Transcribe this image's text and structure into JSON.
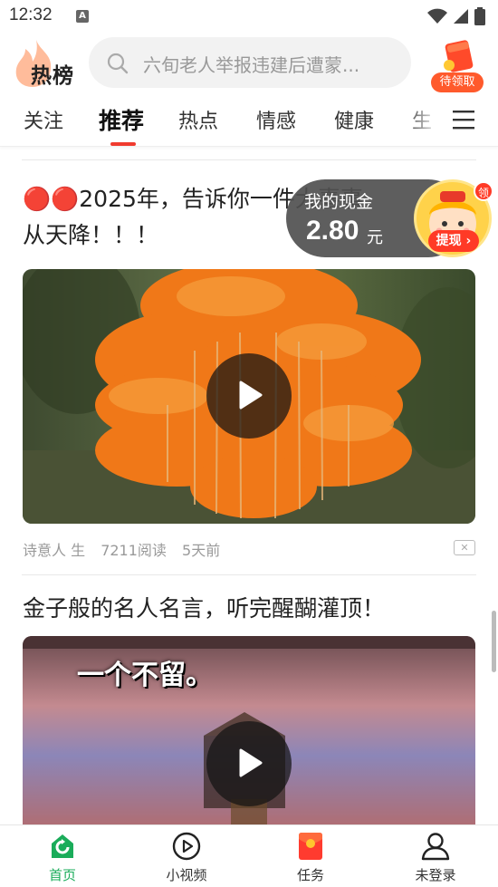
{
  "status_bar": {
    "time": "12:32",
    "notification_icon": "A"
  },
  "header": {
    "logo_text": "热榜",
    "search_placeholder": "六旬老人举报违建后遭蒙...",
    "reward_label": "待领取"
  },
  "tabs": [
    {
      "label": "关注",
      "active": false
    },
    {
      "label": "推荐",
      "active": true
    },
    {
      "label": "热点",
      "active": false
    },
    {
      "label": "情感",
      "active": false
    },
    {
      "label": "健康",
      "active": false
    },
    {
      "label": "生",
      "active": false
    }
  ],
  "colors": {
    "accent_red": "#f03a2e",
    "nav_active_green": "#1aac5a"
  },
  "cash_widget": {
    "label": "我的现金",
    "value": "2.80",
    "unit": "元",
    "button": "提现",
    "badge": "领"
  },
  "feed": [
    {
      "title_line1": "🔴🔴2025年，告诉你一件大喜事",
      "title_line2": "从天降！！！",
      "author": "诗意人 生",
      "reads": "7211阅读",
      "time": "5天前"
    },
    {
      "title": "金子般的名人名言，听完醒醐灌顶！",
      "video_caption": "一个不留。"
    }
  ],
  "bottom_nav": [
    {
      "label": "首页",
      "icon": "home-refresh-icon",
      "active": true
    },
    {
      "label": "小视频",
      "icon": "play-circle-icon",
      "active": false
    },
    {
      "label": "任务",
      "icon": "red-envelope-icon",
      "active": false
    },
    {
      "label": "未登录",
      "icon": "user-icon",
      "active": false
    }
  ]
}
